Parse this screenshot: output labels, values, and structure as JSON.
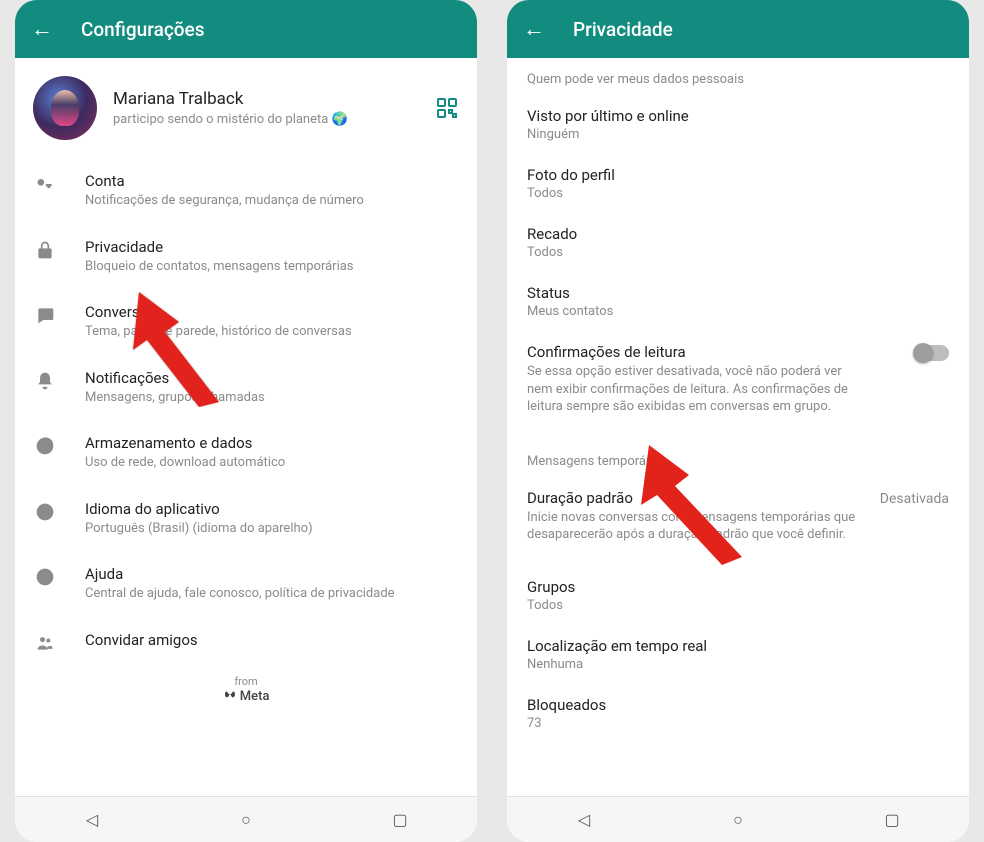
{
  "left": {
    "header": {
      "title": "Configurações"
    },
    "profile": {
      "name": "Mariana Tralback",
      "status": "participo sendo o mistério do planeta 🌍"
    },
    "items": [
      {
        "title": "Conta",
        "desc": "Notificações de segurança, mudança de número"
      },
      {
        "title": "Privacidade",
        "desc": "Bloqueio de contatos, mensagens temporárias"
      },
      {
        "title": "Conversas",
        "desc": "Tema, papel de parede, histórico de conversas"
      },
      {
        "title": "Notificações",
        "desc": "Mensagens, grupos, chamadas"
      },
      {
        "title": "Armazenamento e dados",
        "desc": "Uso de rede, download automático"
      },
      {
        "title": "Idioma do aplicativo",
        "desc": "Português (Brasil) (idioma do aparelho)"
      },
      {
        "title": "Ajuda",
        "desc": "Central de ajuda, fale conosco, política de privacidade"
      },
      {
        "title": "Convidar amigos",
        "desc": ""
      }
    ],
    "footer": {
      "from": "from",
      "meta": "Meta"
    }
  },
  "right": {
    "header": {
      "title": "Privacidade"
    },
    "section1_header": "Quem pode ver meus dados pessoais",
    "items1": [
      {
        "title": "Visto por último e online",
        "value": "Ninguém"
      },
      {
        "title": "Foto do perfil",
        "value": "Todos"
      },
      {
        "title": "Recado",
        "value": "Todos"
      },
      {
        "title": "Status",
        "value": "Meus contatos"
      }
    ],
    "read_receipts": {
      "title": "Confirmações de leitura",
      "desc": "Se essa opção estiver desativada, você não poderá ver nem exibir confirmações de leitura. As confirmações de leitura sempre são exibidas em conversas em grupo."
    },
    "section2_header": "Mensagens temporárias",
    "default_duration": {
      "title": "Duração padrão",
      "desc": "Inicie novas conversas com mensagens temporárias que desaparecerão após a duração padrão que você definir.",
      "value": "Desativada"
    },
    "items2": [
      {
        "title": "Grupos",
        "value": "Todos"
      },
      {
        "title": "Localização em tempo real",
        "value": "Nenhuma"
      },
      {
        "title": "Bloqueados",
        "value": "73"
      }
    ]
  }
}
